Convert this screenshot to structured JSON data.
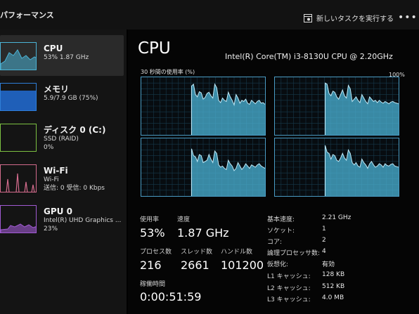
{
  "app": {
    "title": "パフォーマンス"
  },
  "toolbar": {
    "new_task_label": "新しいタスクを実行する",
    "more_label": "•••"
  },
  "sidebar": {
    "items": [
      {
        "name": "CPU",
        "line1": "53% 1.87 GHz",
        "line2": "",
        "color": "#4bb3d6",
        "selected": true
      },
      {
        "name": "メモリ",
        "line1": "5.9/7.9 GB (75%)",
        "line2": "",
        "color": "#2f7ed8",
        "selected": false
      },
      {
        "name": "ディスク 0 (C:)",
        "line1": "SSD (RAID)",
        "line2": "0%",
        "color": "#7cc142",
        "selected": false
      },
      {
        "name": "Wi-Fi",
        "line1": "Wi-Fi",
        "line2": "送信: 0 受信: 0 Kbps",
        "color": "#d26b8c",
        "selected": false
      },
      {
        "name": "GPU 0",
        "line1": "Intel(R) UHD Graphics ...",
        "line2": "23%",
        "color": "#a05ad2",
        "selected": false
      }
    ]
  },
  "main": {
    "title": "CPU",
    "model": "Intel(R) Core(TM) i3-8130U CPU @ 2.20GHz",
    "graph_label": "30 秒間の使用率 (%)",
    "graph_max": "100%",
    "graph_color": "#4bb3d6"
  },
  "stats": {
    "usage_label": "使用率",
    "usage_value": "53%",
    "speed_label": "速度",
    "speed_value": "1.87 GHz",
    "processes_label": "プロセス数",
    "processes_value": "216",
    "threads_label": "スレッド数",
    "threads_value": "2661",
    "handles_label": "ハンドル数",
    "handles_value": "101200",
    "uptime_label": "稼働時間",
    "uptime_value": "0:00:51:59"
  },
  "details": [
    {
      "key": "基本速度:",
      "value": "2.21 GHz"
    },
    {
      "key": "ソケット:",
      "value": "1"
    },
    {
      "key": "コア:",
      "value": "2"
    },
    {
      "key": "論理プロセッサ数:",
      "value": "4"
    },
    {
      "key": "仮想化:",
      "value": "有効"
    },
    {
      "key": "L1 キャッシュ:",
      "value": "128 KB"
    },
    {
      "key": "L2 キャッシュ:",
      "value": "512 KB"
    },
    {
      "key": "L3 キャッシュ:",
      "value": "4.0 MB"
    }
  ],
  "graphs": [
    [
      0,
      0,
      0,
      0,
      0,
      0,
      0,
      0,
      0,
      0,
      0,
      0,
      0,
      0,
      0,
      0,
      0,
      0,
      0,
      0,
      0,
      0,
      0,
      0,
      0,
      0,
      85,
      88,
      70,
      66,
      75,
      73,
      62,
      65,
      72,
      74,
      68,
      64,
      88,
      82,
      60,
      56,
      64,
      60,
      58,
      74,
      66,
      60,
      52,
      70,
      64,
      55,
      60,
      58,
      62,
      55,
      53,
      60,
      57,
      54,
      58,
      60,
      55,
      56,
      53
    ],
    [
      0,
      0,
      0,
      0,
      0,
      0,
      0,
      0,
      0,
      0,
      0,
      0,
      0,
      0,
      0,
      0,
      0,
      0,
      0,
      0,
      0,
      0,
      0,
      0,
      0,
      0,
      90,
      88,
      72,
      68,
      76,
      74,
      66,
      62,
      70,
      78,
      68,
      64,
      86,
      80,
      58,
      62,
      66,
      60,
      56,
      70,
      64,
      58,
      54,
      66,
      62,
      58,
      60,
      56,
      60,
      57,
      55,
      58,
      56,
      54,
      57,
      58,
      56,
      55,
      54
    ],
    [
      0,
      0,
      0,
      0,
      0,
      0,
      0,
      0,
      0,
      0,
      0,
      0,
      0,
      0,
      0,
      0,
      0,
      0,
      0,
      0,
      0,
      0,
      0,
      0,
      0,
      0,
      82,
      70,
      68,
      60,
      72,
      70,
      58,
      60,
      62,
      72,
      64,
      58,
      78,
      74,
      54,
      50,
      52,
      48,
      46,
      62,
      56,
      52,
      44,
      48,
      58,
      52,
      46,
      50,
      56,
      52,
      48,
      54,
      52,
      50,
      54,
      56,
      52,
      50,
      48
    ],
    [
      0,
      0,
      0,
      0,
      0,
      0,
      0,
      0,
      0,
      0,
      0,
      0,
      0,
      0,
      0,
      0,
      0,
      0,
      0,
      0,
      0,
      0,
      0,
      0,
      0,
      0,
      88,
      76,
      74,
      64,
      72,
      70,
      62,
      60,
      66,
      74,
      66,
      62,
      80,
      74,
      58,
      54,
      58,
      52,
      50,
      64,
      58,
      54,
      48,
      56,
      60,
      54,
      50,
      52,
      56,
      54,
      50,
      56,
      53,
      52,
      55,
      56,
      52,
      51,
      50
    ]
  ]
}
